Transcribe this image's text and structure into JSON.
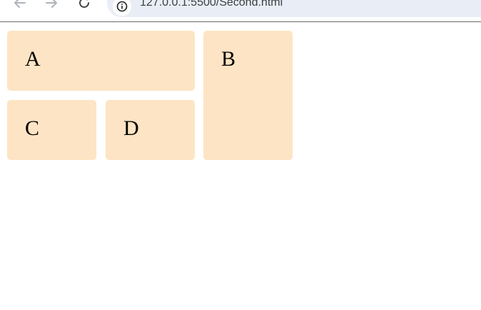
{
  "browser": {
    "url": "127.0.0.1:5500/Second.html",
    "icons": {
      "back": "arrow-left-icon",
      "forward": "arrow-right-icon",
      "reload": "reload-icon",
      "site_info": "info-icon"
    }
  },
  "page": {
    "boxes": [
      {
        "label": "A"
      },
      {
        "label": "B"
      },
      {
        "label": "C"
      },
      {
        "label": "D"
      }
    ],
    "colors": {
      "box_background": "#fde4c4",
      "page_background": "#ffffff"
    }
  }
}
